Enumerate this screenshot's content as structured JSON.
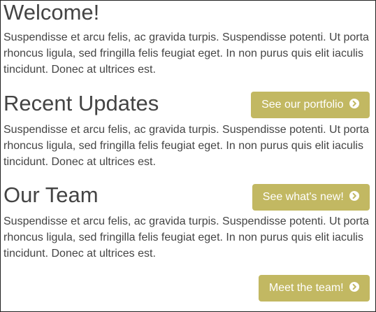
{
  "sections": [
    {
      "title": "Welcome!",
      "text": "Suspendisse et arcu felis, ac gravida turpis. Suspendisse potenti. Ut porta rhoncus ligula, sed fringilla felis feugiat eget. In non purus quis elit iaculis tincidunt. Donec at ultrices est."
    },
    {
      "title": "Recent Updates",
      "text": "Suspendisse et arcu felis, ac gravida turpis. Suspendisse potenti. Ut porta rhoncus ligula, sed fringilla felis feugiat eget. In non purus quis elit iaculis tincidunt. Donec at ultrices est.",
      "button_label": "See our portfolio",
      "button_icon": "chevron-circle-right-icon"
    },
    {
      "title": "Our Team",
      "text": "Suspendisse et arcu felis, ac gravida turpis. Suspendisse potenti. Ut porta rhoncus ligula, sed fringilla felis feugiat eget. In non purus quis elit iaculis tincidunt. Donec at ultrices est.",
      "button_label": "See what's new!",
      "button_icon": "chevron-circle-right-icon"
    }
  ],
  "footer_button": {
    "label": "Meet the team!",
    "icon": "chevron-circle-right-icon"
  },
  "colors": {
    "accent": "#c2b862",
    "text": "#444444",
    "border": "#222222"
  }
}
